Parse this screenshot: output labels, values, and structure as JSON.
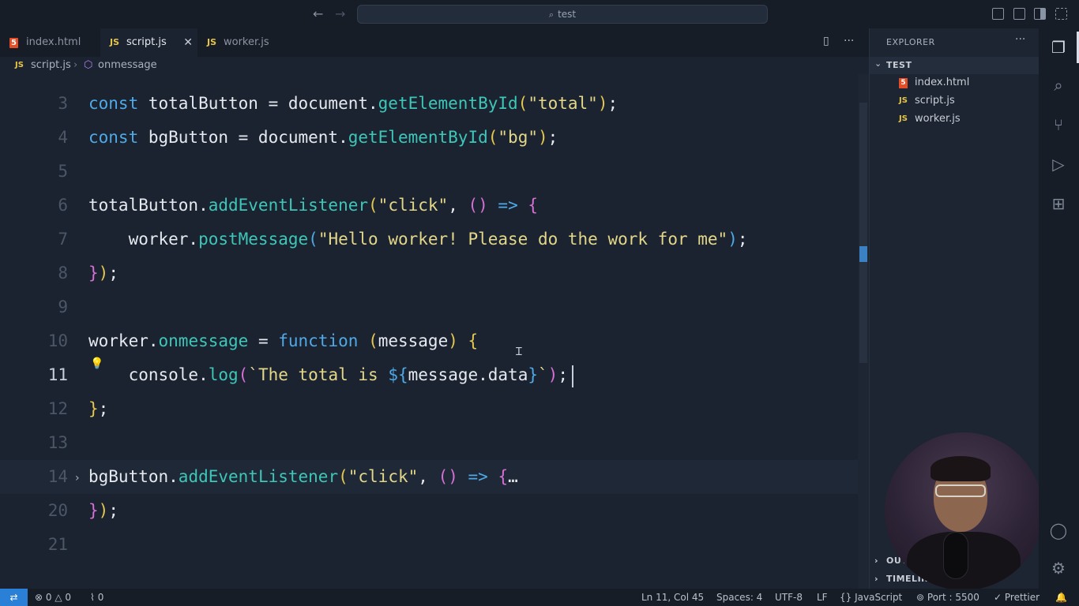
{
  "titlebar": {
    "search_text": "test",
    "search_icon": "search-icon",
    "back_icon": "arrow-left-icon",
    "forward_icon": "arrow-right-icon"
  },
  "tabs": [
    {
      "label": "index.html",
      "icon": "html-file-icon",
      "active": false
    },
    {
      "label": "script.js",
      "icon": "js-file-icon",
      "active": true
    },
    {
      "label": "worker.js",
      "icon": "js-file-icon",
      "active": false
    }
  ],
  "tab_badges": {
    "html": "5",
    "js": "JS"
  },
  "breadcrumb": {
    "file": "script.js",
    "symbol": "onmessage"
  },
  "editor": {
    "line_numbers": [
      "3",
      "4",
      "5",
      "6",
      "7",
      "8",
      "9",
      "10",
      "11",
      "12",
      "13",
      "14",
      "20",
      "21"
    ],
    "lines": [
      {
        "n": "3",
        "tokens": [
          [
            "kw",
            "const"
          ],
          [
            "p",
            " totalButton = document."
          ],
          [
            "fn",
            "getElementById"
          ],
          [
            "b1",
            "("
          ],
          [
            "str",
            "\"total\""
          ],
          [
            "b1",
            ")"
          ],
          [
            "p",
            ";"
          ]
        ]
      },
      {
        "n": "4",
        "tokens": [
          [
            "kw",
            "const"
          ],
          [
            "p",
            " bgButton = document."
          ],
          [
            "fn",
            "getElementById"
          ],
          [
            "b1",
            "("
          ],
          [
            "str",
            "\"bg\""
          ],
          [
            "b1",
            ")"
          ],
          [
            "p",
            ";"
          ]
        ]
      },
      {
        "n": "5",
        "tokens": []
      },
      {
        "n": "6",
        "tokens": [
          [
            "p",
            "totalButton."
          ],
          [
            "fn",
            "addEventListener"
          ],
          [
            "b1",
            "("
          ],
          [
            "str",
            "\"click\""
          ],
          [
            "p",
            ", "
          ],
          [
            "b2",
            "()"
          ],
          [
            "kw",
            " =>"
          ],
          [
            "p",
            " "
          ],
          [
            "b2",
            "{"
          ]
        ]
      },
      {
        "n": "7",
        "tokens": [
          [
            "p",
            "    worker."
          ],
          [
            "fn",
            "postMessage"
          ],
          [
            "b3",
            "("
          ],
          [
            "str",
            "\"Hello worker! Please do the work for me\""
          ],
          [
            "b3",
            ")"
          ],
          [
            "p",
            ";"
          ]
        ]
      },
      {
        "n": "8",
        "tokens": [
          [
            "b2",
            "}"
          ],
          [
            "b1",
            ")"
          ],
          [
            "p",
            ";"
          ]
        ]
      },
      {
        "n": "9",
        "tokens": []
      },
      {
        "n": "10",
        "tokens": [
          [
            "p",
            "worker."
          ],
          [
            "fn",
            "onmessage"
          ],
          [
            "p",
            " = "
          ],
          [
            "kw",
            "function"
          ],
          [
            "p",
            " "
          ],
          [
            "b1",
            "("
          ],
          [
            "p",
            "message"
          ],
          [
            "b1",
            ")"
          ],
          [
            "p",
            " "
          ],
          [
            "b1",
            "{"
          ]
        ]
      },
      {
        "n": "11",
        "tokens": [
          [
            "p",
            "    console."
          ],
          [
            "fn",
            "log"
          ],
          [
            "b2",
            "("
          ],
          [
            "str",
            "`The total is "
          ],
          [
            "tpl",
            "${"
          ],
          [
            "p",
            "message.data"
          ],
          [
            "tpl",
            "}"
          ],
          [
            "str",
            "`"
          ],
          [
            "b2",
            ")"
          ],
          [
            "p",
            ";"
          ]
        ]
      },
      {
        "n": "12",
        "tokens": [
          [
            "b1",
            "}"
          ],
          [
            "p",
            ";"
          ]
        ]
      },
      {
        "n": "13",
        "tokens": []
      },
      {
        "n": "14",
        "tokens": [
          [
            "p",
            "bgButton."
          ],
          [
            "fn",
            "addEventListener"
          ],
          [
            "b1",
            "("
          ],
          [
            "str",
            "\"click\""
          ],
          [
            "p",
            ", "
          ],
          [
            "b2",
            "()"
          ],
          [
            "kw",
            " =>"
          ],
          [
            "p",
            " "
          ],
          [
            "b2",
            "{"
          ],
          [
            "p",
            "…"
          ]
        ]
      },
      {
        "n": "20",
        "tokens": [
          [
            "b2",
            "}"
          ],
          [
            "b1",
            ")"
          ],
          [
            "p",
            ";"
          ]
        ]
      },
      {
        "n": "21",
        "tokens": []
      }
    ],
    "current_line": "11",
    "folded_line": "14"
  },
  "explorer": {
    "title": "EXPLORER",
    "more": "···",
    "folder": "TEST",
    "files": [
      {
        "name": "index.html",
        "icon": "html-file-icon"
      },
      {
        "name": "script.js",
        "icon": "js-file-icon"
      },
      {
        "name": "worker.js",
        "icon": "js-file-icon"
      }
    ],
    "outline": "OUTLINE",
    "timeline": "TIMELINE"
  },
  "activity": [
    "explorer-icon",
    "search-icon",
    "source-control-icon",
    "run-debug-icon",
    "extensions-icon",
    "account-icon",
    "settings-gear-icon"
  ],
  "statusbar": {
    "errors": "0",
    "warnings": "0",
    "ports": "0",
    "position": "Ln 11, Col 45",
    "spaces": "Spaces: 4",
    "encoding": "UTF-8",
    "eol": "LF",
    "language": "JavaScript",
    "port": "Port : 5500",
    "formatter": "Prettier"
  },
  "colors": {
    "keyword": "#4fa9e6",
    "function": "#3ec6b9",
    "string": "#e3d78a",
    "bracket_yellow": "#e6c84f",
    "bracket_magenta": "#d670d6",
    "remote_indicator": "#2a7fd6",
    "background": "#1b2330"
  }
}
